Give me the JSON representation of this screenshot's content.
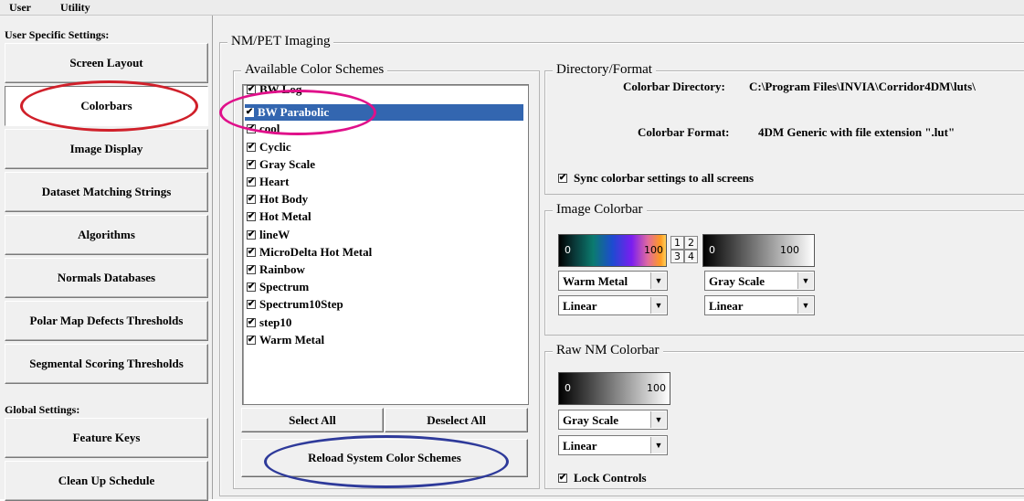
{
  "menu": [
    "User",
    "Utility"
  ],
  "sidebar": {
    "user_heading": "User Specific Settings:",
    "global_heading": "Global Settings:",
    "user_items": [
      "Screen Layout",
      "Colorbars",
      "Image Display",
      "Dataset Matching Strings",
      "Algorithms",
      "Normals Databases",
      "Polar Map Defects Thresholds",
      "Segmental Scoring Thresholds"
    ],
    "global_items": [
      "Feature Keys",
      "Clean Up Schedule"
    ],
    "active": "Colorbars"
  },
  "main": {
    "group_title": "NM/PET Imaging",
    "schemes": {
      "title": "Available Color Schemes",
      "items": [
        {
          "label": "BW Log",
          "checked": true
        },
        {
          "label": "BW Parabolic",
          "checked": true,
          "selected": true
        },
        {
          "label": "cool",
          "checked": true
        },
        {
          "label": "Cyclic",
          "checked": true
        },
        {
          "label": "Gray Scale",
          "checked": true
        },
        {
          "label": "Heart",
          "checked": true
        },
        {
          "label": "Hot Body",
          "checked": true
        },
        {
          "label": "Hot Metal",
          "checked": true
        },
        {
          "label": "lineW",
          "checked": true
        },
        {
          "label": "MicroDelta Hot Metal",
          "checked": true
        },
        {
          "label": "Rainbow",
          "checked": true
        },
        {
          "label": "Spectrum",
          "checked": true
        },
        {
          "label": "Spectrum10Step",
          "checked": true
        },
        {
          "label": "step10",
          "checked": true
        },
        {
          "label": "Warm Metal",
          "checked": true
        }
      ],
      "select_all": "Select All",
      "deselect_all": "Deselect All",
      "reload": "Reload System Color Schemes"
    },
    "directory": {
      "title": "Directory/Format",
      "dir_label": "Colorbar Directory:",
      "dir_value": "C:\\Program Files\\INVIA\\Corridor4DM\\luts\\",
      "format_label": "Colorbar Format:",
      "format_value": "4DM Generic with file extension \".lut\"",
      "sync_label": "Sync colorbar settings to all screens",
      "sync_checked": true
    },
    "image_colorbar": {
      "title": "Image Colorbar",
      "bar1_min": "0",
      "bar1_max": "100",
      "bar2_min": "0",
      "bar2_max": "100",
      "grid": [
        "1",
        "2",
        "3",
        "4"
      ],
      "scheme1": "Warm Metal",
      "scale1": "Linear",
      "scheme2": "Gray Scale",
      "scale2": "Linear"
    },
    "raw_colorbar": {
      "title": "Raw NM Colorbar",
      "bar_min": "0",
      "bar_max": "100",
      "scheme": "Gray Scale",
      "scale": "Linear",
      "lock_label": "Lock Controls",
      "lock_checked": true
    }
  },
  "colors": {
    "selection": "#3366b0",
    "annotation_red": "#d0202a",
    "annotation_magenta": "#e0108a",
    "annotation_blue": "#2e3a9a"
  }
}
